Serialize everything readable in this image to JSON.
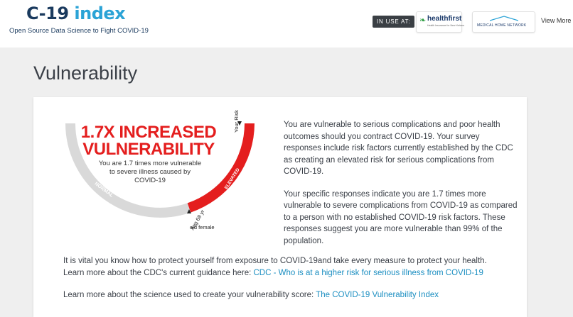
{
  "header": {
    "logo_prefix": "C-19",
    "logo_suffix": "index",
    "tagline": "Open Source Data Science to Fight COVID-19",
    "in_use_label": "IN USE AT:",
    "partners": [
      {
        "name": "healthfirst",
        "subtext": "Health Insurance for New Yorkers"
      },
      {
        "name": "MEDICAL HOME NETWORK"
      }
    ],
    "view_more": "View More"
  },
  "page": {
    "title": "Vulnerability"
  },
  "gauge": {
    "headline": "1.7X INCREASED VULNERABILITY",
    "subtext": "You are 1.7 times more vulnerable to severe illness caused by COVID-19",
    "normal_label": "NORMAL",
    "elevated_label": "ELEVATED",
    "your_risk_label": "Your Risk",
    "avg_line1": "Avg 68 yr",
    "avg_line2": "old female",
    "colors": {
      "normal": "#d9d9d9",
      "elevated": "#e41e1e"
    }
  },
  "content": {
    "paragraph1": "You are vulnerable to serious complications and poor health outcomes should you contract COVID-19. Your survey responses include risk factors currently established by the CDC as creating an elevated risk for serious complications from COVID-19.",
    "paragraph2": "Your specific responses indicate you are 1.7 times more vulnerable to severe complications from COVID-19 as compared to a person with no established COVID-19 risk factors. These responses suggest you are more vulnerable than 99% of the population.",
    "paragraph3": "It is vital you know how to protect yourself from exposure to COVID-19and take every measure to protect your health.",
    "paragraph3b_prefix": "Learn more about the CDC's current guidance here: ",
    "cdc_link": "CDC - Who is at a higher risk for serious illness from COVID-19",
    "paragraph4_prefix": "Learn more about the science used to create your vulnerability score: ",
    "index_link": "The COVID-19 Vulnerability Index"
  }
}
